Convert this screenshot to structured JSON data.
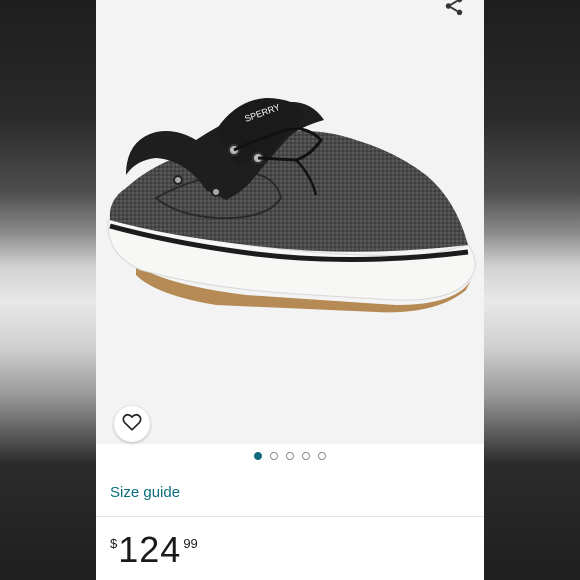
{
  "product": {
    "brand_tongue_label": "SPERRY",
    "image_alt": "Gray canvas two-eye boat shoe with black leather collar and white sole"
  },
  "actions": {
    "share_icon": "share-icon",
    "favorite_icon": "heart-outline-icon"
  },
  "carousel": {
    "total": 5,
    "active_index": 0
  },
  "links": {
    "size_guide": "Size guide"
  },
  "price": {
    "currency": "$",
    "whole": "124",
    "cents": "99"
  },
  "colors": {
    "accent": "#0a6d7c",
    "active_dot": "#0e6c7a"
  }
}
